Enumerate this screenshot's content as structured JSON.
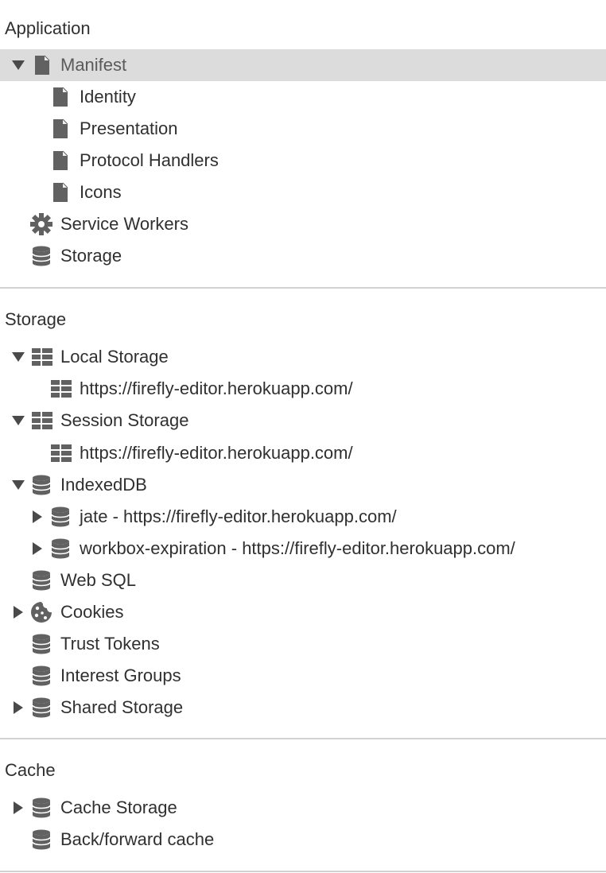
{
  "sections": {
    "application": {
      "title": "Application",
      "items": {
        "manifest": "Manifest",
        "identity": "Identity",
        "presentation": "Presentation",
        "protocol_handlers": "Protocol Handlers",
        "icons": "Icons",
        "service_workers": "Service Workers",
        "storage": "Storage"
      }
    },
    "storage": {
      "title": "Storage",
      "items": {
        "local_storage": "Local Storage",
        "local_origin": "https://firefly-editor.herokuapp.com/",
        "session_storage": "Session Storage",
        "session_origin": "https://firefly-editor.herokuapp.com/",
        "indexeddb": "IndexedDB",
        "db_jate": "jate - https://firefly-editor.herokuapp.com/",
        "db_workbox": "workbox-expiration - https://firefly-editor.herokuapp.com/",
        "web_sql": "Web SQL",
        "cookies": "Cookies",
        "trust_tokens": "Trust Tokens",
        "interest_groups": "Interest Groups",
        "shared_storage": "Shared Storage"
      }
    },
    "cache": {
      "title": "Cache",
      "items": {
        "cache_storage": "Cache Storage",
        "back_forward_cache": "Back/forward cache"
      }
    }
  },
  "colors": {
    "selected_row": "#dcdcdc",
    "icon": "#616161",
    "divider": "#d2d2d2"
  }
}
